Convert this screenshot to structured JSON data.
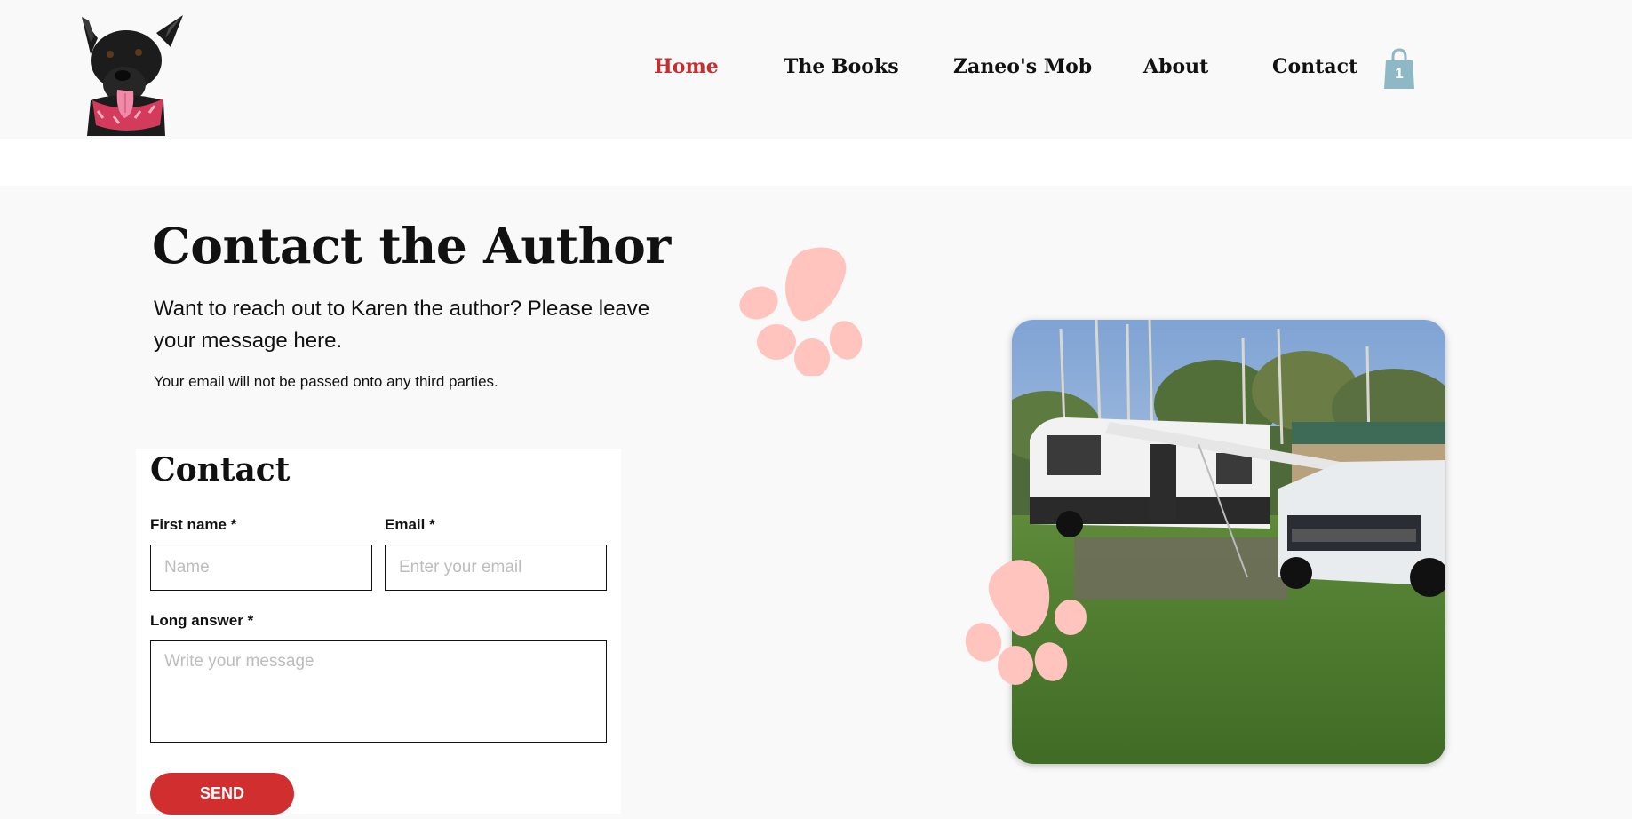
{
  "header": {
    "nav": [
      {
        "label": "Home",
        "active": true
      },
      {
        "label": "The Books",
        "active": false
      },
      {
        "label": "Zaneo's Mob",
        "active": false
      },
      {
        "label": "About",
        "active": false
      },
      {
        "label": "Contact",
        "active": false
      }
    ],
    "cart_count": "1",
    "logo_icon": "dog-logo-icon",
    "cart_icon": "shopping-bag-icon"
  },
  "main": {
    "title": "Contact the Author",
    "subtitle": "Want to reach out to Karen the author? Please leave your message here.",
    "note": "Your email will not be passed onto any third parties."
  },
  "form": {
    "title": "Contact",
    "first_name": {
      "label": "First name *",
      "placeholder": "Name",
      "value": ""
    },
    "email": {
      "label": "Email *",
      "placeholder": "Enter your email",
      "value": ""
    },
    "long_answer": {
      "label": "Long answer *",
      "placeholder": "Write your message",
      "value": ""
    },
    "send_label": "SEND"
  },
  "colors": {
    "accent": "#c62f2f",
    "send_button": "#d12f2f",
    "paw": "#ffc4be",
    "cart": "#8fb8c6",
    "page_background": "#f9f9f9"
  },
  "decor": {
    "paw_icon": "paw-print-icon",
    "photo_subject": "camper-trailer-photo"
  }
}
